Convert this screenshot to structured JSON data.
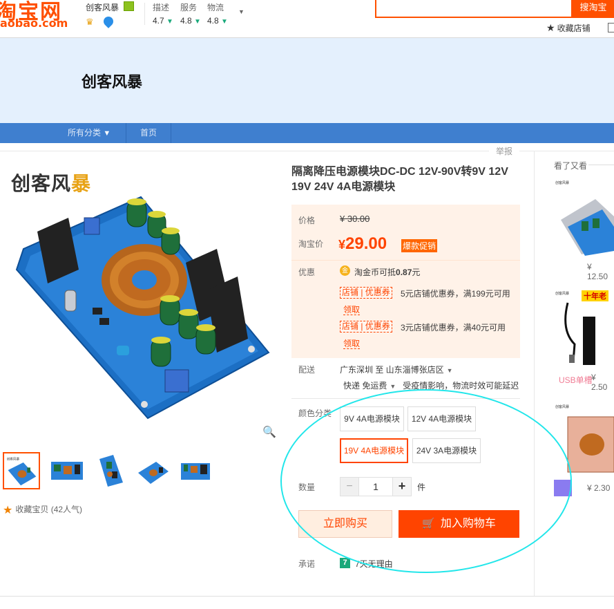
{
  "header": {
    "logo_cn": "淘宝网",
    "logo_en": "aobao.com",
    "shop_name": "创客风暴",
    "ratings": [
      {
        "label": "描述",
        "value": "4.7"
      },
      {
        "label": "服务",
        "value": "4.8"
      },
      {
        "label": "物流",
        "value": "4.8"
      }
    ],
    "search_button": "搜淘宝",
    "fav_shop": "收藏店铺"
  },
  "banner": {
    "title": "创客风暴"
  },
  "nav": {
    "all_categories": "所有分类",
    "home": "首页"
  },
  "report": "举报",
  "gallery": {
    "logo_text_a": "创客风",
    "logo_text_b": "暴",
    "collect_label": "收藏宝贝",
    "collect_count": "(42人气)"
  },
  "product": {
    "title": "隔离降压电源模块DC-DC 12V-90V转9V 12V 19V 24V 4A电源模块",
    "price_label": "价格",
    "orig_price": "¥ 30.00",
    "tb_price_label": "淘宝价",
    "currency": "¥",
    "price": "29.00",
    "promo_badge": "爆款促销",
    "discount_label": "优惠",
    "coin_text_a": "淘金币可抵",
    "coin_amount": "0.87",
    "coin_text_b": "元",
    "coupons": [
      {
        "tag": "店铺 | 优惠券",
        "text": "5元店铺优惠券，满199元可用",
        "get": "领取"
      },
      {
        "tag": "店铺 | 优惠券",
        "text": "3元店铺优惠券，满40元可用",
        "get": "领取"
      }
    ],
    "ship_label": "配送",
    "ship_from": "广东深圳 至  山东淄博张店区",
    "ship_type": "快递 免运费",
    "ship_note": "受疫情影响，物流时效可能延迟",
    "color_label": "颜色分类",
    "skus": [
      "9V 4A电源模块",
      "12V 4A电源模块",
      "19V 4A电源模块",
      "24V 3A电源模块"
    ],
    "selected_sku": "19V 4A电源模块",
    "qty_label": "数量",
    "qty_minus": "−",
    "qty": "1",
    "qty_plus": "+",
    "qty_unit": "件",
    "buy_now": "立即购买",
    "add_cart": "加入购物车",
    "promise_label": "承诺",
    "promise_icon": "7",
    "promise_text": "7天无理由"
  },
  "sidebar": {
    "title": "看了又看",
    "items": [
      {
        "price": "¥ 12.50"
      },
      {
        "price": "¥ 2.50",
        "overlay": "十年老",
        "bottom_text": "USB单槽"
      },
      {
        "price": "¥ 2.30"
      }
    ]
  },
  "colors": {
    "brand": "#ff5000",
    "price": "#ff4400",
    "nav": "#3f7fcf",
    "banner": "#e4f0fd",
    "annotation": "#22e6ea"
  }
}
